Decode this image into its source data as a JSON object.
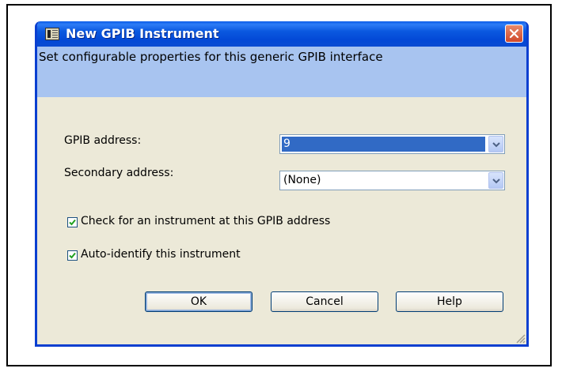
{
  "window": {
    "title": "New GPIB Instrument",
    "description": "Set configurable properties for this generic GPIB interface"
  },
  "form": {
    "gpib_address": {
      "label": "GPIB address:",
      "value": "9"
    },
    "secondary_address": {
      "label": "Secondary address:",
      "value": "(None)"
    },
    "check_instrument": {
      "label": "Check for an instrument at this GPIB address",
      "checked": true
    },
    "auto_identify": {
      "label": "Auto-identify this instrument",
      "checked": true
    }
  },
  "buttons": {
    "ok": "OK",
    "cancel": "Cancel",
    "help": "Help"
  },
  "colors": {
    "title_bar": "#0a58df",
    "banner": "#a8c4f0",
    "selection": "#316ac5",
    "dialog_bg": "#ece9d8"
  },
  "icons": [
    "app-icon",
    "close-icon",
    "chevron-down-icon",
    "checkmark-icon",
    "resize-grip-icon"
  ]
}
